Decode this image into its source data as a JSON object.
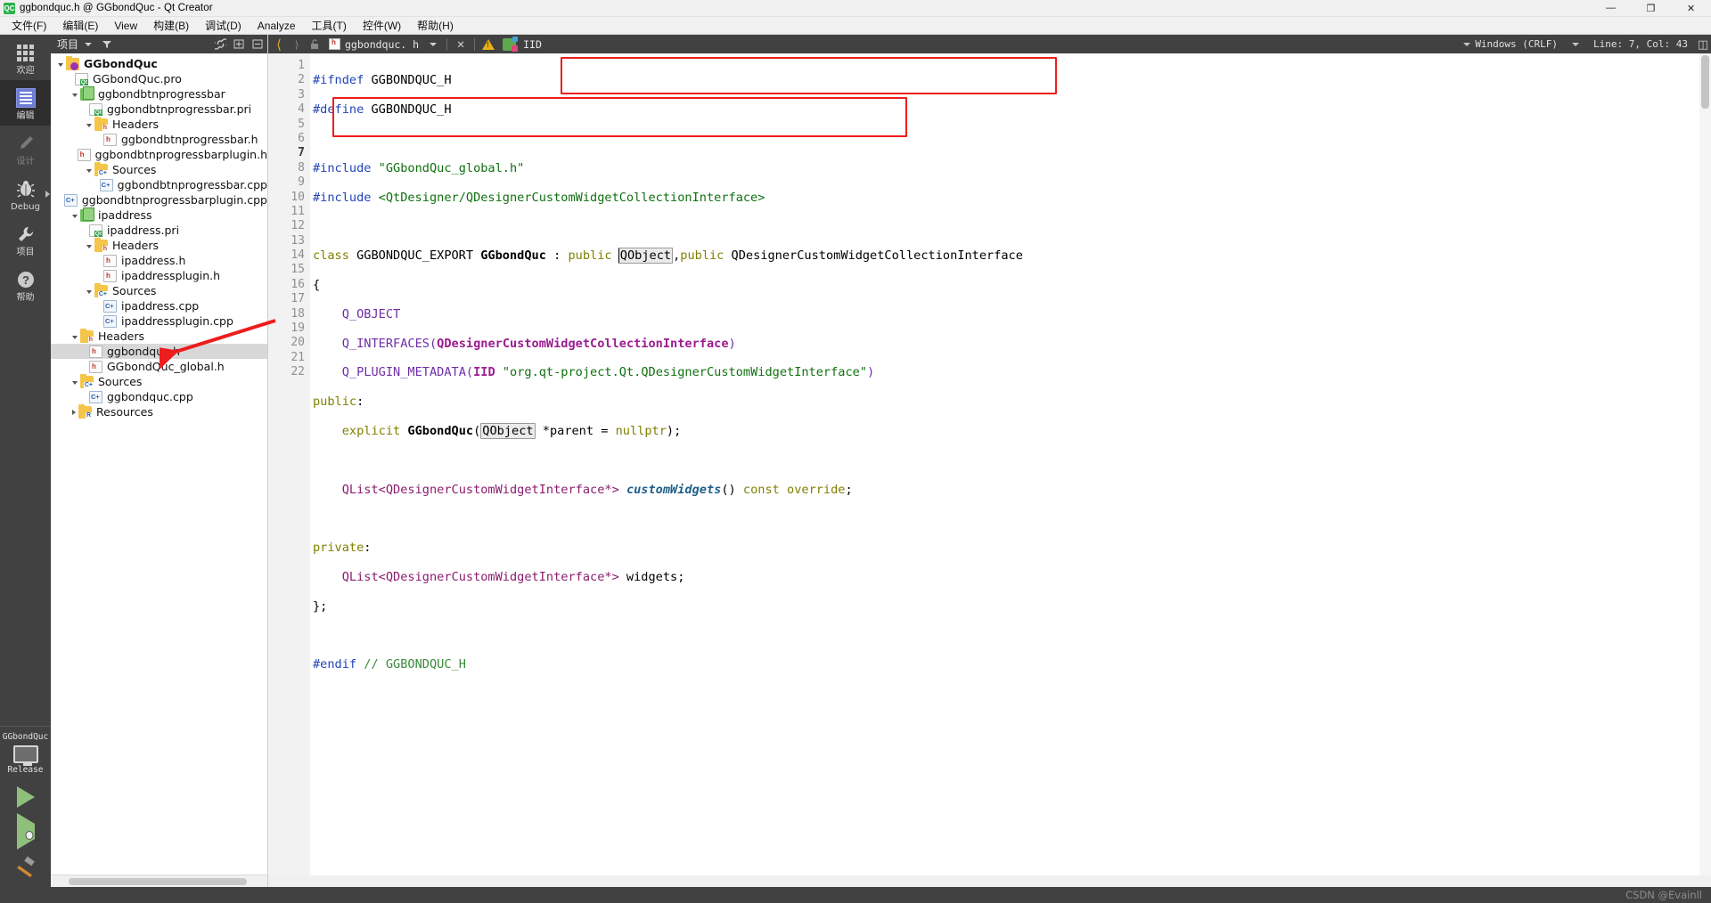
{
  "window": {
    "title": "ggbondquc.h @ GGbondQuc - Qt Creator",
    "app_icon": "QC",
    "minimize": "—",
    "maximize": "❐",
    "close": "✕"
  },
  "menubar": {
    "items": [
      {
        "label": "文件(F)"
      },
      {
        "label": "编辑(E)"
      },
      {
        "label": "View"
      },
      {
        "label": "构建(B)"
      },
      {
        "label": "调试(D)"
      },
      {
        "label": "Analyze"
      },
      {
        "label": "工具(T)"
      },
      {
        "label": "控件(W)"
      },
      {
        "label": "帮助(H)"
      }
    ]
  },
  "modebar": {
    "modes": [
      {
        "label": "欢迎",
        "icon": "grid-icon",
        "active": false
      },
      {
        "label": "编辑",
        "icon": "edit-icon",
        "active": true
      },
      {
        "label": "设计",
        "icon": "pencil-icon",
        "active": false
      },
      {
        "label": "Debug",
        "icon": "bug-icon",
        "active": false
      },
      {
        "label": "项目",
        "icon": "wrench-icon",
        "active": false
      },
      {
        "label": "帮助",
        "icon": "question-icon",
        "active": false
      }
    ],
    "kit": {
      "project": "GGbondQuc",
      "build_config": "Release",
      "monitor_icon": "desktop-icon"
    },
    "actions": [
      {
        "name": "run-button",
        "icon": "play-icon"
      },
      {
        "name": "debug-button",
        "icon": "play-bug-icon"
      },
      {
        "name": "build-button",
        "icon": "hammer-icon"
      }
    ]
  },
  "project_panel": {
    "header": {
      "title": "项目",
      "dropdown_icon": "chevron-down-icon",
      "filter_icon": "filter-icon",
      "link_icon": "link-icon",
      "expand_icon": "expand-all-icon",
      "close_icon": "close-icon"
    },
    "tree": [
      {
        "label": "GGbondQuc",
        "indent": 0,
        "icon": "project",
        "twisty": "open",
        "bold": true,
        "selected": false
      },
      {
        "label": "GGbondQuc.pro",
        "indent": 1,
        "icon": "doc",
        "twisty": "none",
        "bold": false,
        "selected": false
      },
      {
        "label": "ggbondbtnprogressbar",
        "indent": 1,
        "icon": "subproj",
        "twisty": "open",
        "bold": false,
        "selected": false
      },
      {
        "label": "ggbondbtnprogressbar.pri",
        "indent": 2,
        "icon": "doc",
        "twisty": "none",
        "bold": false,
        "selected": false
      },
      {
        "label": "Headers",
        "indent": 2,
        "icon": "folder-h",
        "twisty": "open",
        "bold": false,
        "selected": false
      },
      {
        "label": "ggbondbtnprogressbar.h",
        "indent": 3,
        "icon": "header",
        "twisty": "none",
        "bold": false,
        "selected": false
      },
      {
        "label": "ggbondbtnprogressbarplugin.h",
        "indent": 3,
        "icon": "header",
        "twisty": "none",
        "bold": false,
        "selected": false
      },
      {
        "label": "Sources",
        "indent": 2,
        "icon": "folder-c",
        "twisty": "open",
        "bold": false,
        "selected": false
      },
      {
        "label": "ggbondbtnprogressbar.cpp",
        "indent": 3,
        "icon": "cpp",
        "twisty": "none",
        "bold": false,
        "selected": false
      },
      {
        "label": "ggbondbtnprogressbarplugin.cpp",
        "indent": 3,
        "icon": "cpp",
        "twisty": "none",
        "bold": false,
        "selected": false
      },
      {
        "label": "ipaddress",
        "indent": 1,
        "icon": "subproj",
        "twisty": "open",
        "bold": false,
        "selected": false
      },
      {
        "label": "ipaddress.pri",
        "indent": 2,
        "icon": "doc",
        "twisty": "none",
        "bold": false,
        "selected": false
      },
      {
        "label": "Headers",
        "indent": 2,
        "icon": "folder-h",
        "twisty": "open",
        "bold": false,
        "selected": false
      },
      {
        "label": "ipaddress.h",
        "indent": 3,
        "icon": "header",
        "twisty": "none",
        "bold": false,
        "selected": false
      },
      {
        "label": "ipaddressplugin.h",
        "indent": 3,
        "icon": "header",
        "twisty": "none",
        "bold": false,
        "selected": false
      },
      {
        "label": "Sources",
        "indent": 2,
        "icon": "folder-c",
        "twisty": "open",
        "bold": false,
        "selected": false
      },
      {
        "label": "ipaddress.cpp",
        "indent": 3,
        "icon": "cpp",
        "twisty": "none",
        "bold": false,
        "selected": false
      },
      {
        "label": "ipaddressplugin.cpp",
        "indent": 3,
        "icon": "cpp",
        "twisty": "none",
        "bold": false,
        "selected": false
      },
      {
        "label": "Headers",
        "indent": 1,
        "icon": "folder-h",
        "twisty": "open",
        "bold": false,
        "selected": false
      },
      {
        "label": "ggbondquc.h",
        "indent": 2,
        "icon": "header",
        "twisty": "none",
        "bold": false,
        "selected": true
      },
      {
        "label": "GGbondQuc_global.h",
        "indent": 2,
        "icon": "header",
        "twisty": "none",
        "bold": false,
        "selected": false
      },
      {
        "label": "Sources",
        "indent": 1,
        "icon": "folder-c",
        "twisty": "open",
        "bold": false,
        "selected": false
      },
      {
        "label": "ggbondquc.cpp",
        "indent": 2,
        "icon": "cpp",
        "twisty": "none",
        "bold": false,
        "selected": false
      },
      {
        "label": "Resources",
        "indent": 1,
        "icon": "folder-r",
        "twisty": "closed",
        "bold": false,
        "selected": false
      }
    ]
  },
  "editor": {
    "toolbar": {
      "back_icon": "chevron-left-icon",
      "forward_icon": "chevron-right-icon",
      "lock_icon": "unlock-icon",
      "file_icon": "header-file-icon",
      "filename": "ggbondquc. h",
      "dropdown_icon": "chevron-down-icon",
      "close_icon": "close-icon",
      "warning_icon": "warning-icon",
      "symbol_icon": "class-symbol-icon",
      "symbol_label": "IID",
      "encoding": "Windows (CRLF)",
      "cursor_position": "Line: 7, Col: 43",
      "split_icon": "split-editor-icon"
    },
    "line_numbers": [
      "1",
      "2",
      "3",
      "4",
      "5",
      "6",
      "7",
      "8",
      "9",
      "10",
      "11",
      "12",
      "13",
      "14",
      "15",
      "16",
      "17",
      "18",
      "19",
      "20",
      "21",
      "22"
    ],
    "current_line": "7",
    "code_lines": [
      "#ifndef GGBONDQUC_H",
      "#define GGBONDQUC_H",
      "",
      "#include \"GGbondQuc_global.h\"",
      "#include <QtDesigner/QDesignerCustomWidgetCollectionInterface>",
      "",
      "class GGBONDQUC_EXPORT GGbondQuc : public QObject,public QDesignerCustomWidgetCollectionInterface",
      "{",
      "    Q_OBJECT",
      "    Q_INTERFACES(QDesignerCustomWidgetCollectionInterface)",
      "    Q_PLUGIN_METADATA(IID \"org.qt-project.Qt.QDesignerCustomWidgetInterface\")",
      "public:",
      "    explicit GGbondQuc(QObject *parent = nullptr);",
      "",
      "    QList<QDesignerCustomWidgetInterface*> customWidgets() const override;",
      "",
      "private:",
      "    QList<QDesignerCustomWidgetInterface*> widgets;",
      "};",
      "",
      "#endif // GGBONDQUC_H",
      ""
    ],
    "annotations": [
      {
        "name": "redbox-inheritance",
        "note": "red rectangle around class base-list on line 7"
      },
      {
        "name": "redbox-macros",
        "note": "red rectangle around Q_INTERFACES / Q_PLUGIN_METADATA lines 10-11"
      },
      {
        "name": "red-arrow-to-ggbondquc-h",
        "note": "red arrow pointing at selected tree item ggbondquc.h"
      }
    ]
  },
  "watermark": {
    "text": "CSDN @Evainll"
  },
  "colors": {
    "accent_dark": "#414141",
    "mode_active": "#2e2e2e",
    "annotation_red": "#ee1d1d",
    "selection_grey": "#d8d8d8",
    "gutter_bg": "#f2f2f2"
  }
}
